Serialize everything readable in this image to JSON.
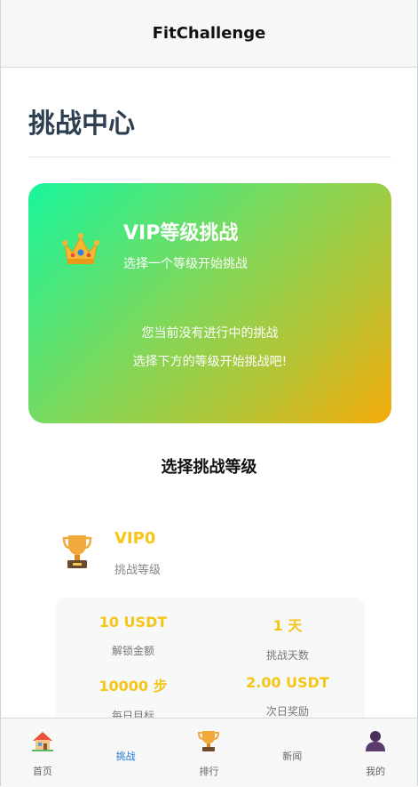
{
  "app": {
    "title": "FitChallenge"
  },
  "page": {
    "title": "挑战中心"
  },
  "hero": {
    "title": "VIP等级挑战",
    "subtitle": "选择一个等级开始挑战",
    "empty_line1": "您当前没有进行中的挑战",
    "empty_line2": "选择下方的等级开始挑战吧!",
    "gradient": [
      "#19f59c",
      "#f5aa0a"
    ]
  },
  "levels": {
    "section_title": "选择挑战等级",
    "items": [
      {
        "name": "VIP0",
        "subtitle": "挑战等级",
        "stats": [
          {
            "value": "10 USDT",
            "label": "解锁金额"
          },
          {
            "value": "1 天",
            "label": "挑战天数"
          },
          {
            "value": "10000 步",
            "label": "每日目标"
          },
          {
            "value": "2.00 USDT",
            "label": "次日奖励"
          }
        ]
      }
    ]
  },
  "tabbar": {
    "items": [
      {
        "label": "首页",
        "icon": "home-icon"
      },
      {
        "label": "挑战",
        "icon": "",
        "active": true
      },
      {
        "label": "排行",
        "icon": "trophy-icon"
      },
      {
        "label": "新闻",
        "icon": ""
      },
      {
        "label": "我的",
        "icon": "user-icon"
      }
    ]
  },
  "colors": {
    "accent": "#f5c518",
    "active_tab": "#1e7bd6",
    "title": "#2c3e50"
  }
}
